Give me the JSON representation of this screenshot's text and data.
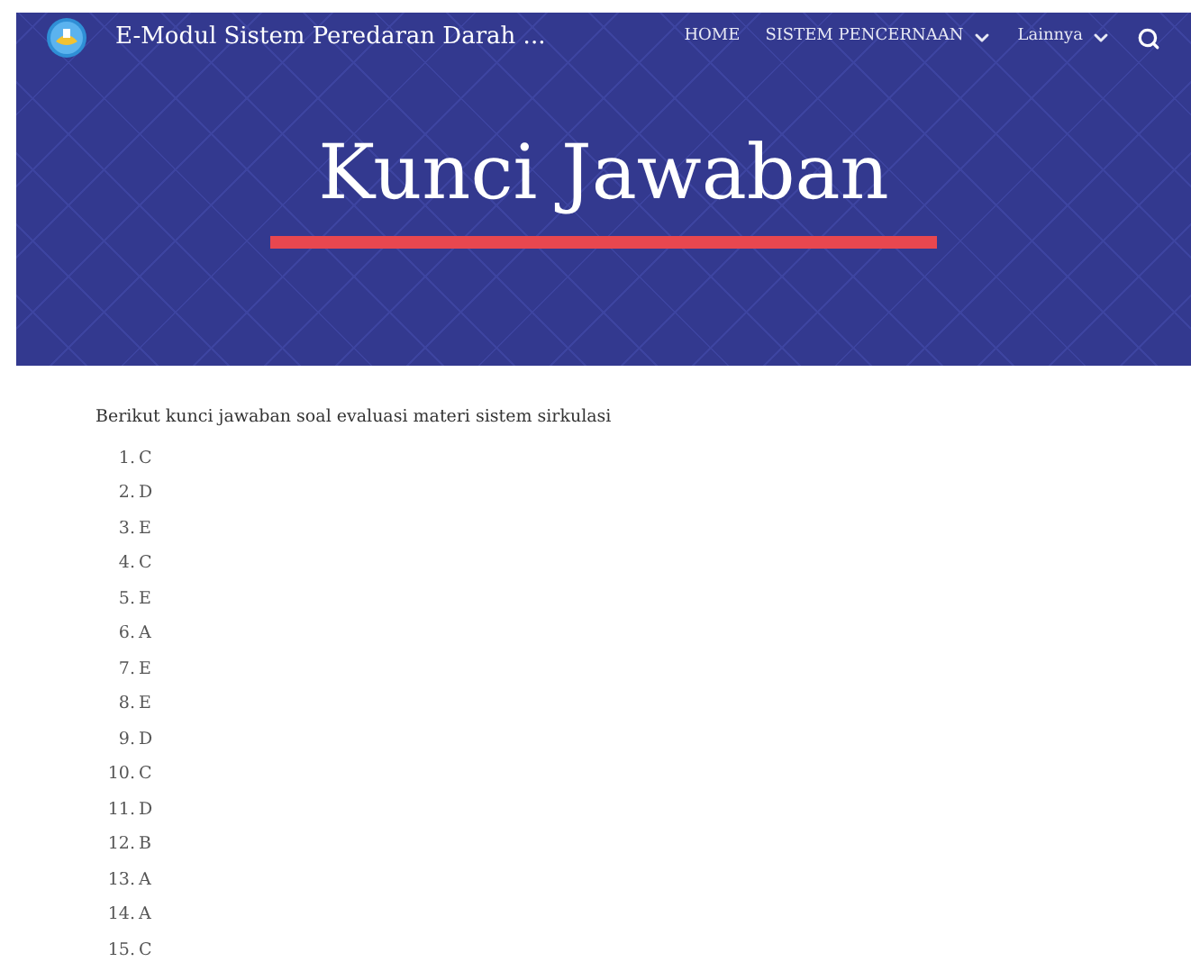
{
  "header": {
    "site_title": "E-Modul Sistem Peredaran Darah ...",
    "nav": [
      {
        "label": "HOME",
        "kind": "link"
      },
      {
        "label": "SISTEM PENCERNAAN",
        "kind": "dropdown"
      },
      {
        "label": "Lainnya",
        "kind": "dropdown"
      }
    ]
  },
  "banner": {
    "title": "Kunci Jawaban"
  },
  "content": {
    "intro": "Berikut kunci jawaban soal evaluasi materi sistem sirkulasi",
    "answers": [
      {
        "number": "1.",
        "answer": "C"
      },
      {
        "number": "2.",
        "answer": "D"
      },
      {
        "number": "3.",
        "answer": "E"
      },
      {
        "number": "4.",
        "answer": "C"
      },
      {
        "number": "5.",
        "answer": "E"
      },
      {
        "number": "6.",
        "answer": "A"
      },
      {
        "number": "7.",
        "answer": "E"
      },
      {
        "number": "8.",
        "answer": "E"
      },
      {
        "number": "9.",
        "answer": "D"
      },
      {
        "number": "10.",
        "answer": "C"
      },
      {
        "number": "11.",
        "answer": "D"
      },
      {
        "number": "12.",
        "answer": "B"
      },
      {
        "number": "13.",
        "answer": "A"
      },
      {
        "number": "14.",
        "answer": "A"
      },
      {
        "number": "15.",
        "answer": "C"
      }
    ]
  }
}
